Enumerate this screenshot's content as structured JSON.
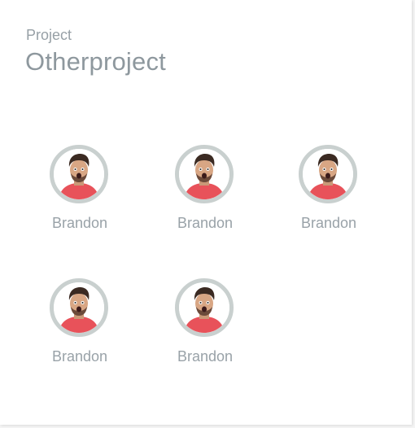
{
  "header": {
    "eyebrow": "Project",
    "title": "Otherproject"
  },
  "members": [
    {
      "name": "Brandon",
      "avatar_icon": "user-avatar-icon"
    },
    {
      "name": "Brandon",
      "avatar_icon": "user-avatar-icon"
    },
    {
      "name": "Brandon",
      "avatar_icon": "user-avatar-icon"
    },
    {
      "name": "Brandon",
      "avatar_icon": "user-avatar-icon"
    },
    {
      "name": "Brandon",
      "avatar_icon": "user-avatar-icon"
    }
  ],
  "colors": {
    "avatar_ring": "#c9d0cf",
    "text_muted": "#99a2a8",
    "shirt": "#e8525a"
  }
}
